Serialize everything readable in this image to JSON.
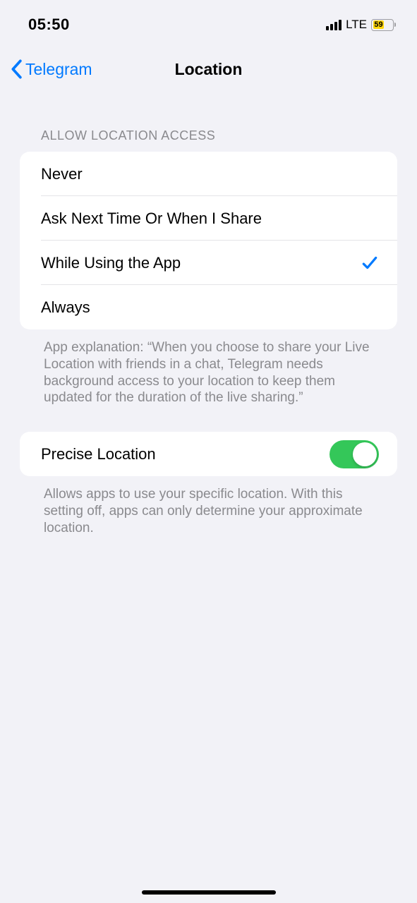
{
  "status": {
    "time": "05:50",
    "network": "LTE",
    "battery_pct": "59"
  },
  "nav": {
    "back_label": "Telegram",
    "title": "Location"
  },
  "access": {
    "header": "ALLOW LOCATION ACCESS",
    "options": {
      "never": "Never",
      "ask": "Ask Next Time Or When I Share",
      "while_using": "While Using the App",
      "always": "Always"
    },
    "selected": "while_using",
    "footer": "App explanation: “When you choose to share your Live Location with friends in a chat, Telegram needs background access to your location to keep them updated for the duration of the live sharing.”"
  },
  "precise": {
    "label": "Precise Location",
    "enabled": true,
    "footer": "Allows apps to use your specific location. With this setting off, apps can only determine your approximate location."
  },
  "colors": {
    "accent": "#007aff",
    "toggle_on": "#34c759",
    "battery_fill": "#ffd60a"
  }
}
